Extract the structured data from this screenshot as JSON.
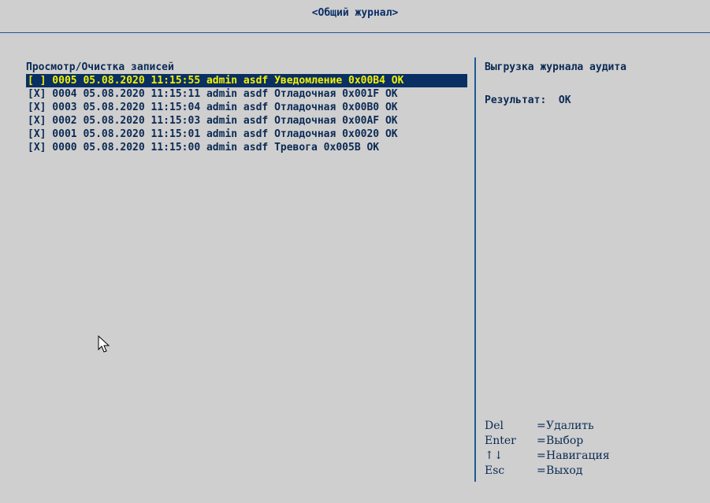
{
  "window": {
    "title": "<Общий журнал>"
  },
  "log": {
    "section_title": "Просмотр/Очистка записей",
    "entries": [
      {
        "text": "[ ] 0005 05.08.2020 11:15:55 admin asdf Уведомление 0x00B4 OK",
        "selected": true
      },
      {
        "text": "[X] 0004 05.08.2020 11:15:11 admin asdf Отладочная 0x001F OK",
        "selected": false
      },
      {
        "text": "[X] 0003 05.08.2020 11:15:04 admin asdf Отладочная 0x00B0 OK",
        "selected": false
      },
      {
        "text": "[X] 0002 05.08.2020 11:15:03 admin asdf Отладочная 0x00AF OK",
        "selected": false
      },
      {
        "text": "[X] 0001 05.08.2020 11:15:01 admin asdf Отладочная 0x0020 OK",
        "selected": false
      },
      {
        "text": "[X] 0000 05.08.2020 11:15:00 admin asdf Тревога 0x005B OK",
        "selected": false
      }
    ]
  },
  "help": {
    "title": "Выгрузка журнала аудита",
    "result": "Результат:  OK"
  },
  "legend": [
    {
      "key": "Del",
      "eq": "=",
      "desc": "Удалить"
    },
    {
      "key": "Enter",
      "eq": "=",
      "desc": "Выбор"
    },
    {
      "key": "↑↓",
      "eq": "=",
      "desc": "Навигация"
    },
    {
      "key": "Esc",
      "eq": "=",
      "desc": "Выход"
    }
  ],
  "colors": {
    "background": "#cfcfcf",
    "text": "#0b2a54",
    "selected_bg": "#0a2f63",
    "selected_text": "#f2f200",
    "divider": "#1f5a96"
  },
  "icons": {
    "cursor": "mouse-pointer-icon"
  }
}
